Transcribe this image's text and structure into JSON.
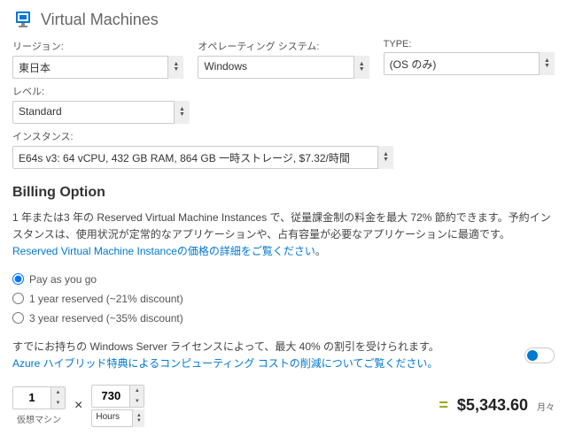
{
  "header": {
    "title": "Virtual Machines"
  },
  "fields": {
    "region": {
      "label": "リージョン:",
      "value": "東日本"
    },
    "os": {
      "label": "オペレーティング システム:",
      "value": "Windows"
    },
    "type": {
      "label": "TYPE:",
      "value": "(OS のみ)"
    },
    "level": {
      "label": "レベル:",
      "value": "Standard"
    },
    "instance": {
      "label": "インスタンス:",
      "value": "E64s v3: 64 vCPU, 432 GB RAM, 864 GB 一時ストレージ, $7.32/時間"
    }
  },
  "billing": {
    "title": "Billing Option",
    "desc_pre": "1 年または3 年の Reserved Virtual Machine Instances で、従量課金制の料金を最大 72% 節約できます。予約インスタンスは、使用状況が定常的なアプリケーションや、占有容量が必要なアプリケーションに最適です。",
    "desc_link": "Reserved Virtual Machine Instanceの価格の詳細をご覧ください",
    "desc_post": "。",
    "options": {
      "payg": "Pay as you go",
      "r1": "1 year reserved (~21% discount)",
      "r3": "3 year reserved (~35% discount)"
    }
  },
  "hybrid": {
    "line1": "すでにお持ちの Windows Server ライセンスによって、最大 40% の割引を受けられます。",
    "link": "Azure ハイブリッド特典によるコンピューティング コストの削減についてご覧ください。"
  },
  "calc": {
    "qty": "1",
    "qty_label": "仮想マシン",
    "hours": "730",
    "hours_unit": "Hours",
    "price": "$5,343.60",
    "price_unit": "月々"
  }
}
